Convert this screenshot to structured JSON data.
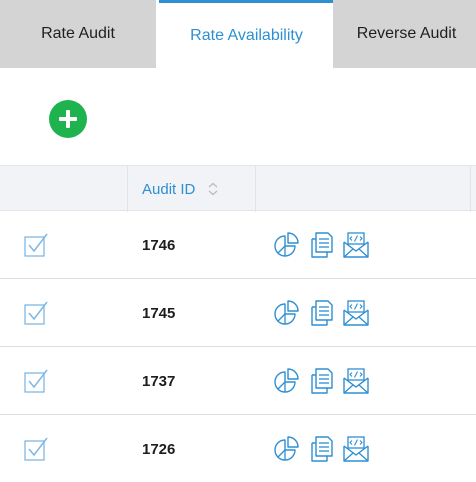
{
  "tabs": [
    {
      "label": "Rate Audit",
      "active": false
    },
    {
      "label": "Rate Availability",
      "active": true
    },
    {
      "label": "Reverse Audit",
      "active": false
    }
  ],
  "add_button": {
    "icon": "plus-icon",
    "color": "#1eb34f"
  },
  "table": {
    "header": {
      "audit_id": "Audit ID",
      "sort_icon": "sort-updown-icon"
    },
    "rows": [
      {
        "checked": true,
        "audit_id": "1746",
        "actions": [
          "pie-chart-icon",
          "document-icon",
          "code-email-icon"
        ]
      },
      {
        "checked": true,
        "audit_id": "1745",
        "actions": [
          "pie-chart-icon",
          "document-icon",
          "code-email-icon"
        ]
      },
      {
        "checked": true,
        "audit_id": "1737",
        "actions": [
          "pie-chart-icon",
          "document-icon",
          "code-email-icon"
        ]
      },
      {
        "checked": true,
        "audit_id": "1726",
        "actions": [
          "pie-chart-icon",
          "document-icon",
          "code-email-icon"
        ]
      }
    ]
  },
  "colors": {
    "accent": "#2e8fd3",
    "tab_inactive_bg": "#d4d4d4",
    "header_bg": "#f1f3f7"
  }
}
